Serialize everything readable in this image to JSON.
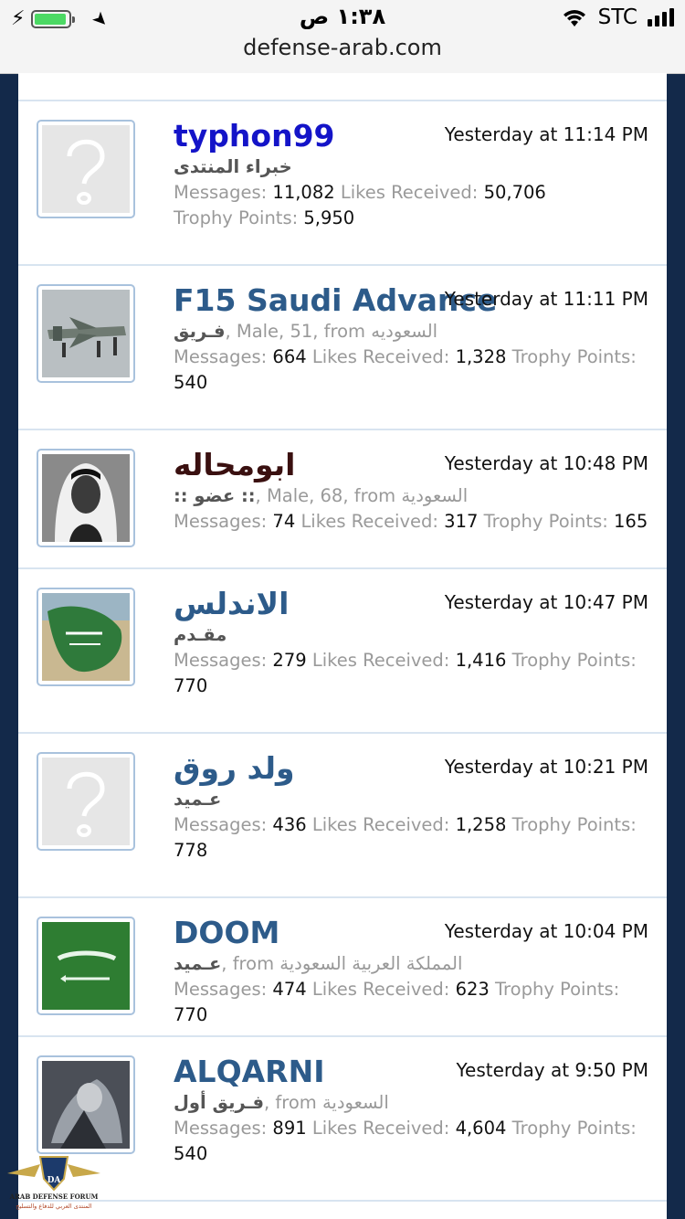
{
  "status_bar": {
    "time": "١:٣٨ ص",
    "carrier": "STC"
  },
  "url": "defense-arab.com",
  "labels": {
    "messages": "Messages:",
    "likes": "Likes Received:",
    "trophy": "Trophy Points:"
  },
  "members": [
    {
      "name": "typhon99",
      "time": "Yesterday at 11:14 PM",
      "title": "خبراء المنتدى",
      "extra": "",
      "messages": "11,082",
      "likes": "50,706",
      "trophy": "5,950"
    },
    {
      "name": "F15 Saudi Advance",
      "time": "Yesterday at 11:11 PM",
      "title": "فـريق",
      "extra": ", Male, 51, from السعوديه",
      "messages": "664",
      "likes": "1,328",
      "trophy": "540"
    },
    {
      "name": "ابومحاله",
      "time": "Yesterday at 10:48 PM",
      "title": ":: عضو ::",
      "extra": ", Male, 68, from السعودية",
      "messages": "74",
      "likes": "317",
      "trophy": "165"
    },
    {
      "name": "الاندلس",
      "time": "Yesterday at 10:47 PM",
      "title": "مقـدم",
      "extra": "",
      "messages": "279",
      "likes": "1,416",
      "trophy": "770"
    },
    {
      "name": "ولد روق",
      "time": "Yesterday at 10:21 PM",
      "title": "عـميد",
      "extra": "",
      "messages": "436",
      "likes": "1,258",
      "trophy": "778"
    },
    {
      "name": "DOOM",
      "time": "Yesterday at 10:04 PM",
      "title": "عـميد",
      "extra": ", from المملكة العربية السعودية",
      "messages": "474",
      "likes": "623",
      "trophy": "770"
    },
    {
      "name": "ALQARNI",
      "time": "Yesterday at 9:50 PM",
      "title": "فـريق أول",
      "extra": ", from السعودية",
      "messages": "891",
      "likes": "4,604",
      "trophy": "540"
    }
  ],
  "logo": {
    "text1": "ARAB DEFENSE FORUM",
    "text2": "المنتدى العربي للدفاع والتسليح"
  },
  "colors": {
    "link": "#2d5b8a",
    "online": "#1414c8",
    "bg": "#13294a"
  }
}
